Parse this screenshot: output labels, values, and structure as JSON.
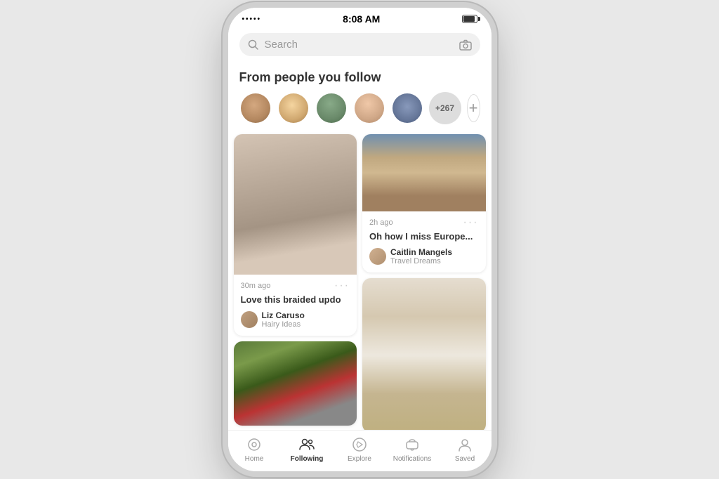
{
  "statusBar": {
    "dots": "•••••",
    "time": "8:08 AM"
  },
  "searchBar": {
    "placeholder": "Search"
  },
  "sectionTitle": "From people you follow",
  "followers": {
    "moreBadge": "+267",
    "addButton": "+"
  },
  "pins": [
    {
      "id": "hair",
      "type": "left",
      "imageType": "hair",
      "time": "30m ago",
      "title": "Love this braided updo",
      "authorName": "Liz Caruso",
      "authorBoard": "Hairy Ideas"
    },
    {
      "id": "europe",
      "type": "right",
      "imageType": "europe",
      "time": "2h ago",
      "title": "Oh how I miss Europe...",
      "authorName": "Caitlin Mangels",
      "authorBoard": "Travel Dreams"
    },
    {
      "id": "food",
      "type": "left",
      "imageType": "food",
      "time": "",
      "title": "",
      "authorName": "",
      "authorBoard": ""
    },
    {
      "id": "interior",
      "type": "right",
      "imageType": "interior",
      "time": "",
      "title": "",
      "authorName": "",
      "authorBoard": ""
    }
  ],
  "bottomNav": [
    {
      "id": "home",
      "label": "Home",
      "active": false
    },
    {
      "id": "following",
      "label": "Following",
      "active": true
    },
    {
      "id": "explore",
      "label": "Explore",
      "active": false
    },
    {
      "id": "notifications",
      "label": "Notifications",
      "active": false
    },
    {
      "id": "saved",
      "label": "Saved",
      "active": false
    }
  ]
}
